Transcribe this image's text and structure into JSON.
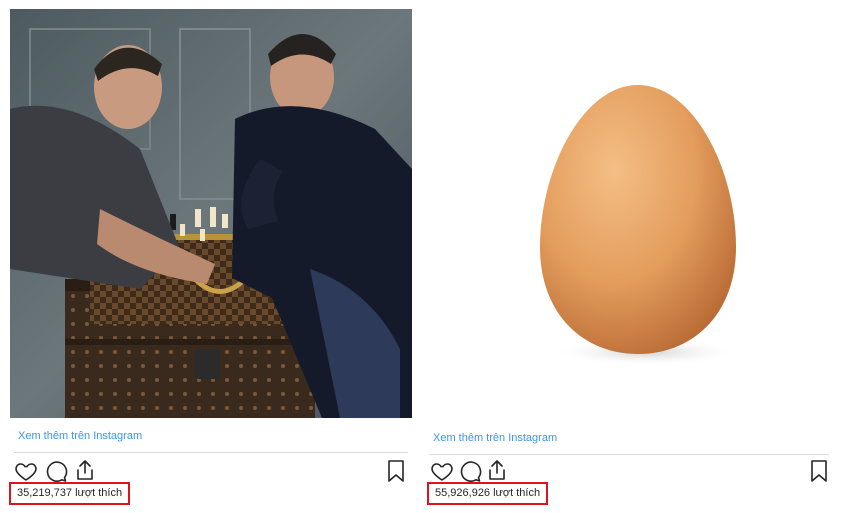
{
  "posts": [
    {
      "image_alt": "",
      "more_link": "Xem thêm trên Instagram",
      "likes": "35,219,737 lượt thích",
      "icons": [
        "heart-icon",
        "comment-icon",
        "share-icon",
        "bookmark-icon"
      ]
    },
    {
      "image_alt": "",
      "more_link": "Xem thêm trên Instagram",
      "likes": "55,926,926 lượt thích",
      "icons": [
        "heart-icon",
        "comment-icon",
        "share-icon",
        "bookmark-icon"
      ]
    }
  ],
  "colors": {
    "link": "#3897f0",
    "highlight_box": "#e0121b",
    "text": "#262626",
    "divider": "#dbdbdb",
    "egg": "#e8a566"
  }
}
